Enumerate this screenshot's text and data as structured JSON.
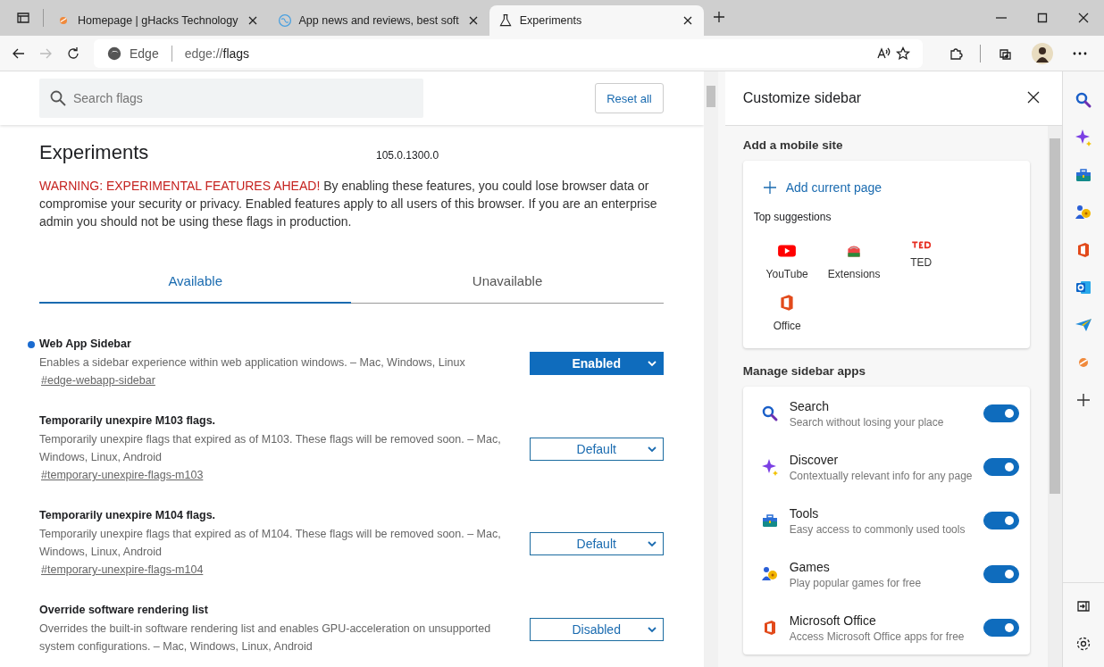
{
  "browser_tabs": [
    {
      "title": "Homepage | gHacks Technology",
      "kind": "ghacks",
      "selected": false
    },
    {
      "title": "App news and reviews, best soft",
      "kind": "globe",
      "selected": false
    },
    {
      "title": "Experiments",
      "kind": "flask",
      "selected": true
    }
  ],
  "address_bar": {
    "site_label": "Edge",
    "url_scheme": "edge://",
    "url_path": "flags"
  },
  "flags_page": {
    "search": {
      "placeholder": "Search flags"
    },
    "reset_button": "Reset all",
    "title": "Experiments",
    "version": "105.0.1300.0",
    "warning": {
      "alert": "WARNING: EXPERIMENTAL FEATURES AHEAD!",
      "text": " By enabling these features, you could lose browser data or compromise your security or privacy. Enabled features apply to all users of this browser. If you are an enterprise admin you should not be using these flags in production."
    },
    "tabs": [
      {
        "label": "Available",
        "selected": true
      },
      {
        "label": "Unavailable",
        "selected": false
      }
    ],
    "flags": [
      {
        "name": "Web App Sidebar",
        "modified": true,
        "description": "Enables a sidebar experience within web application windows. – Mac, Windows, Linux",
        "link": "#edge-webapp-sidebar",
        "value": "Enabled"
      },
      {
        "name": "Temporarily unexpire M103 flags.",
        "modified": false,
        "description": "Temporarily unexpire flags that expired as of M103. These flags will be removed soon. – Mac, Windows, Linux, Android",
        "link": "#temporary-unexpire-flags-m103",
        "value": "Default"
      },
      {
        "name": "Temporarily unexpire M104 flags.",
        "modified": false,
        "description": "Temporarily unexpire flags that expired as of M104. These flags will be removed soon. – Mac, Windows, Linux, Android",
        "link": "#temporary-unexpire-flags-m104",
        "value": "Default"
      },
      {
        "name": "Override software rendering list",
        "modified": false,
        "description": "Overrides the built-in software rendering list and enables GPU-acceleration on unsupported system configurations. – Mac, Windows, Linux, Android",
        "value": "Disabled"
      }
    ]
  },
  "customize_panel": {
    "title": "Customize sidebar",
    "mobile_section": "Add a mobile site",
    "add_current_page": "Add current page",
    "suggestions_title": "Top suggestions",
    "suggestions": [
      {
        "label": "YouTube",
        "kind": "youtube"
      },
      {
        "label": "Extensions",
        "kind": "store"
      },
      {
        "label": "TED",
        "kind": "ted"
      },
      {
        "label": "Office",
        "kind": "office"
      }
    ],
    "apps_section": "Manage sidebar apps",
    "apps": [
      {
        "name": "Search",
        "description": "Search without losing your place",
        "kind": "search",
        "on": true
      },
      {
        "name": "Discover",
        "description": "Contextually relevant info for any page",
        "kind": "sparkle",
        "on": true
      },
      {
        "name": "Tools",
        "description": "Easy access to commonly used tools",
        "kind": "toolbox",
        "on": true
      },
      {
        "name": "Games",
        "description": "Play popular games for free",
        "kind": "games",
        "on": true
      },
      {
        "name": "Microsoft Office",
        "description": "Access Microsoft Office apps for free",
        "kind": "office",
        "on": true
      }
    ]
  },
  "sidebar_apps": [
    {
      "kind": "search"
    },
    {
      "kind": "sparkle"
    },
    {
      "kind": "toolbox"
    },
    {
      "kind": "games"
    },
    {
      "kind": "office"
    },
    {
      "kind": "outlook"
    },
    {
      "kind": "send"
    },
    {
      "kind": "ghacks"
    },
    {
      "kind": "plus"
    }
  ]
}
